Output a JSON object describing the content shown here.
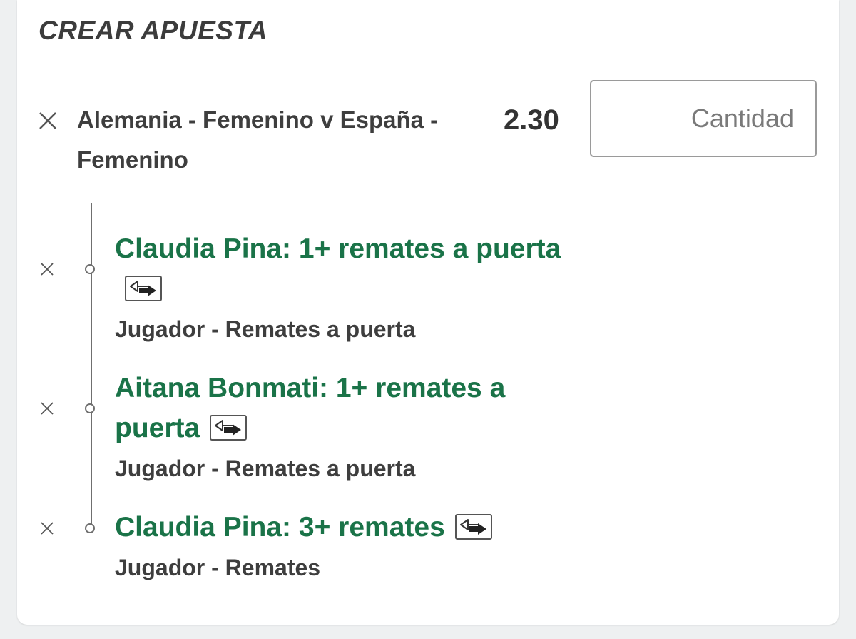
{
  "bet_builder": {
    "title": "CREAR APUESTA",
    "event": {
      "name": "Alemania - Femenino v España - Femenino",
      "odds": "2.30"
    },
    "stake": {
      "placeholder": "Cantidad",
      "value": ""
    },
    "selections": [
      {
        "name": "Claudia Pina: 1+ remates a puerta",
        "market": "Jugador - Remates a puerta"
      },
      {
        "name": "Aitana Bonmati: 1+ remates a puerta",
        "market": "Jugador - Remates a puerta"
      },
      {
        "name": "Claudia Pina: 3+ remates",
        "market": "Jugador - Remates"
      }
    ],
    "icons": {
      "remove": "close-icon",
      "swap": "swap-arrows-icon"
    },
    "colors": {
      "selection_text": "#1a7348",
      "text": "#3e3e3e",
      "background": "#eef0f1"
    }
  }
}
